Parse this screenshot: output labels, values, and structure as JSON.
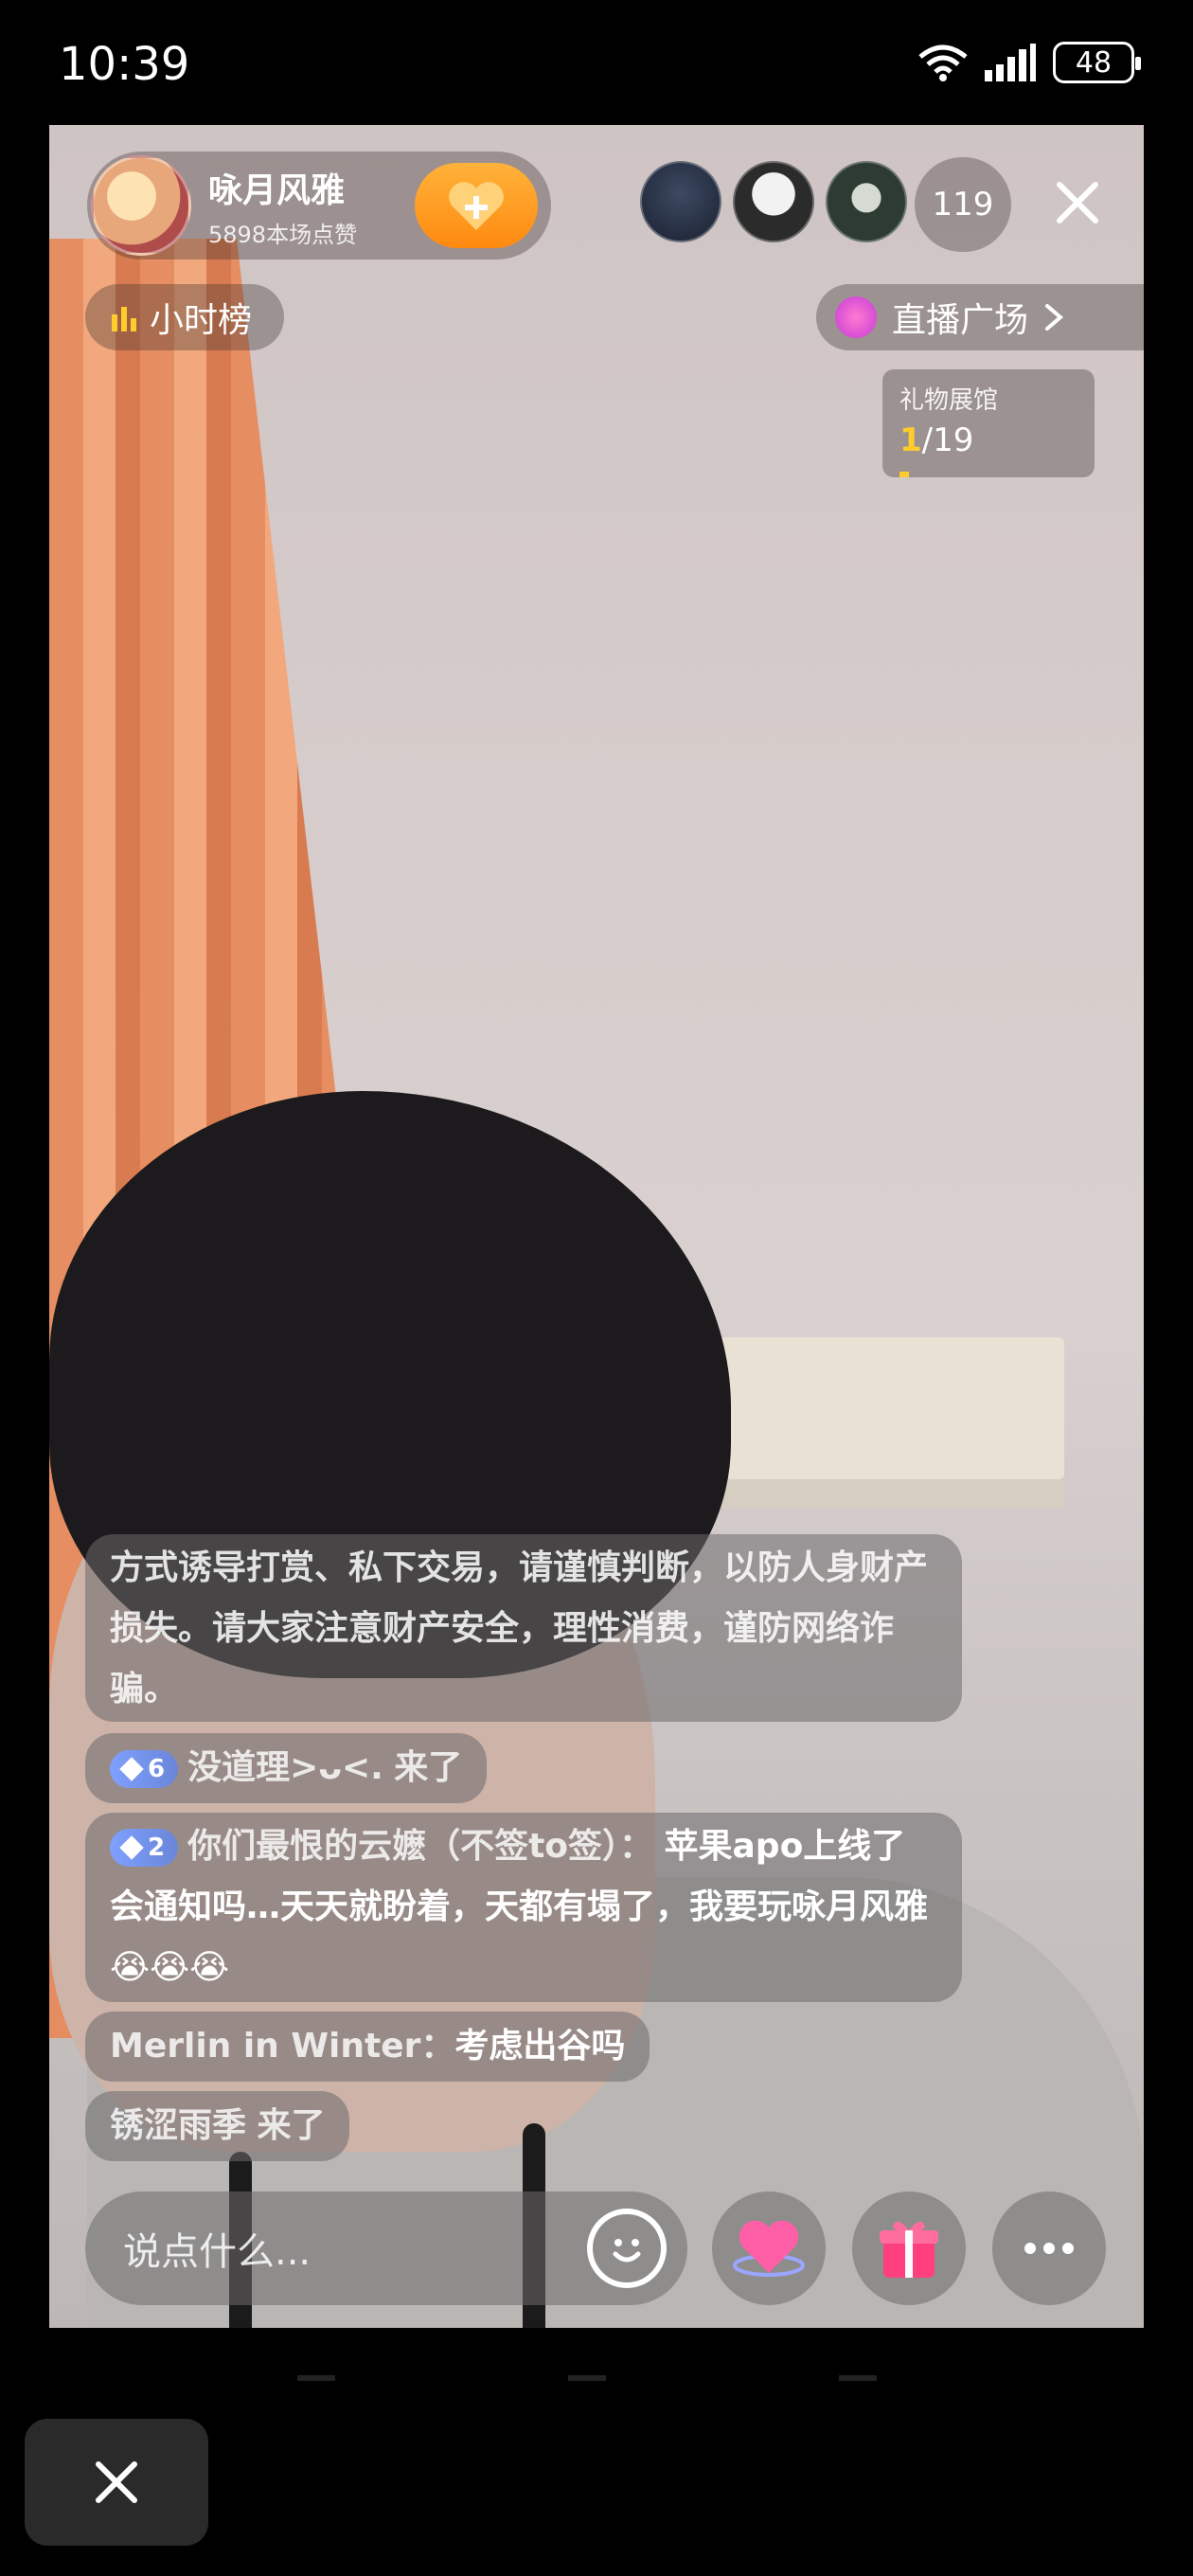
{
  "status_bar": {
    "time": "10:39",
    "battery": "48"
  },
  "host": {
    "name": "咏月风雅",
    "likes": "5898本场点赞"
  },
  "viewers": {
    "count": "119"
  },
  "rank_label": "小时榜",
  "plaza_label": "直播广场",
  "gift_hall": {
    "title": "礼物展馆",
    "current": "1",
    "total": "/19"
  },
  "chat": {
    "notice": "方式诱导打赏、私下交易，请谨慎判断，以防人身财产损失。请大家注意财产安全，理性消费，谨防网络诈骗。",
    "messages": [
      {
        "level": "6",
        "user": "没道理>ᴗ<.",
        "content": "来了"
      },
      {
        "level": "2",
        "user": "你们最恨的云嬷（不签to签）：",
        "content": "苹果apo上线了会通知吗…天天就盼着，天都有塌了，我要玩咏月风雅😭😭😭"
      },
      {
        "user": "Merlin in Winter：",
        "content": "考虑出谷吗"
      },
      {
        "user": "锈涩雨季",
        "content": "来了"
      }
    ]
  },
  "input": {
    "placeholder": "说点什么..."
  },
  "colors": {
    "accent_orange": "#ff9a1f",
    "gold": "#ffcc2b",
    "level_badge": "#7fa0ff"
  }
}
